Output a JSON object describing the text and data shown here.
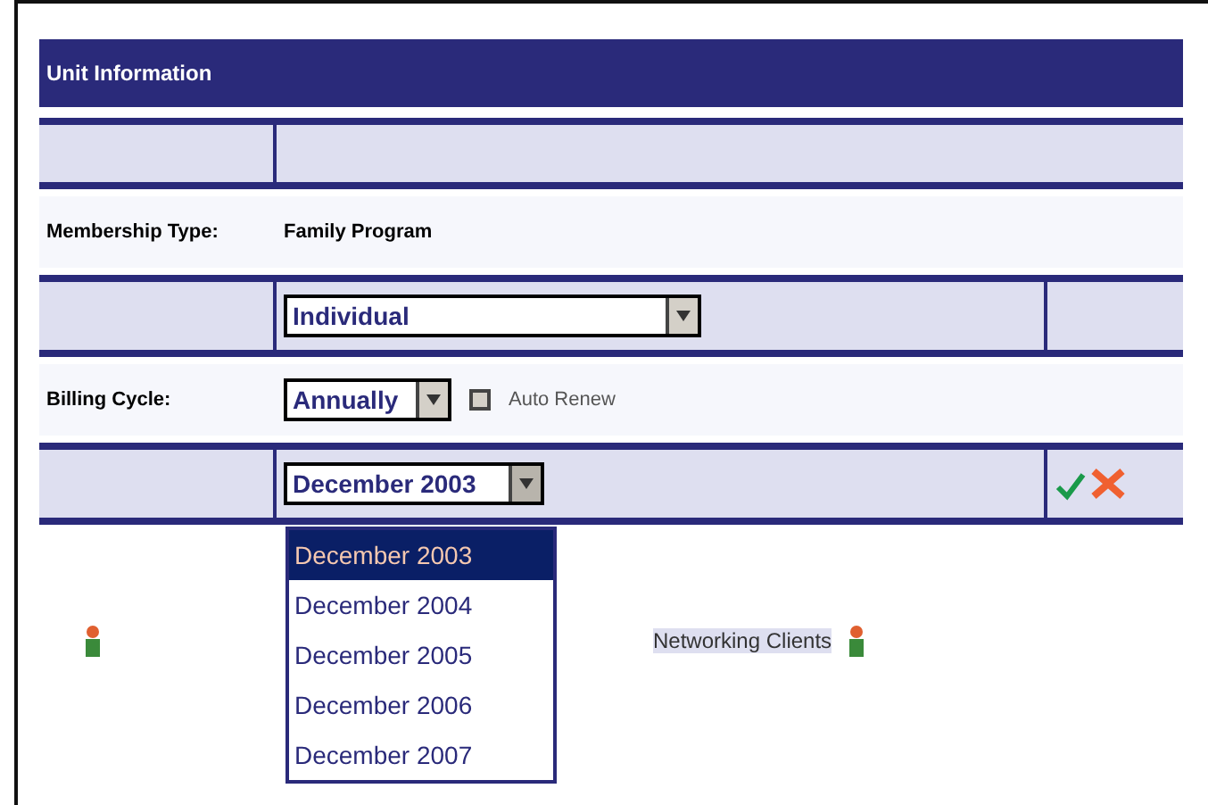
{
  "panel": {
    "title": "Unit Information"
  },
  "membership": {
    "label": "Membership Type:",
    "value": "Family Program"
  },
  "plan_select": {
    "value": "Individual"
  },
  "billing": {
    "label": "Billing Cycle:",
    "cycle": "Annually",
    "auto_renew": {
      "label": "Auto Renew",
      "checked": false
    }
  },
  "date_select": {
    "value": "December 2003",
    "expanded": true,
    "options": [
      {
        "label": "December 2003",
        "selected": true
      },
      {
        "label": "December 2004",
        "selected": false
      },
      {
        "label": "December 2005",
        "selected": false
      },
      {
        "label": "December 2006",
        "selected": false
      },
      {
        "label": "December 2007",
        "selected": false
      }
    ]
  },
  "footer": {
    "link": "Networking Clients"
  }
}
